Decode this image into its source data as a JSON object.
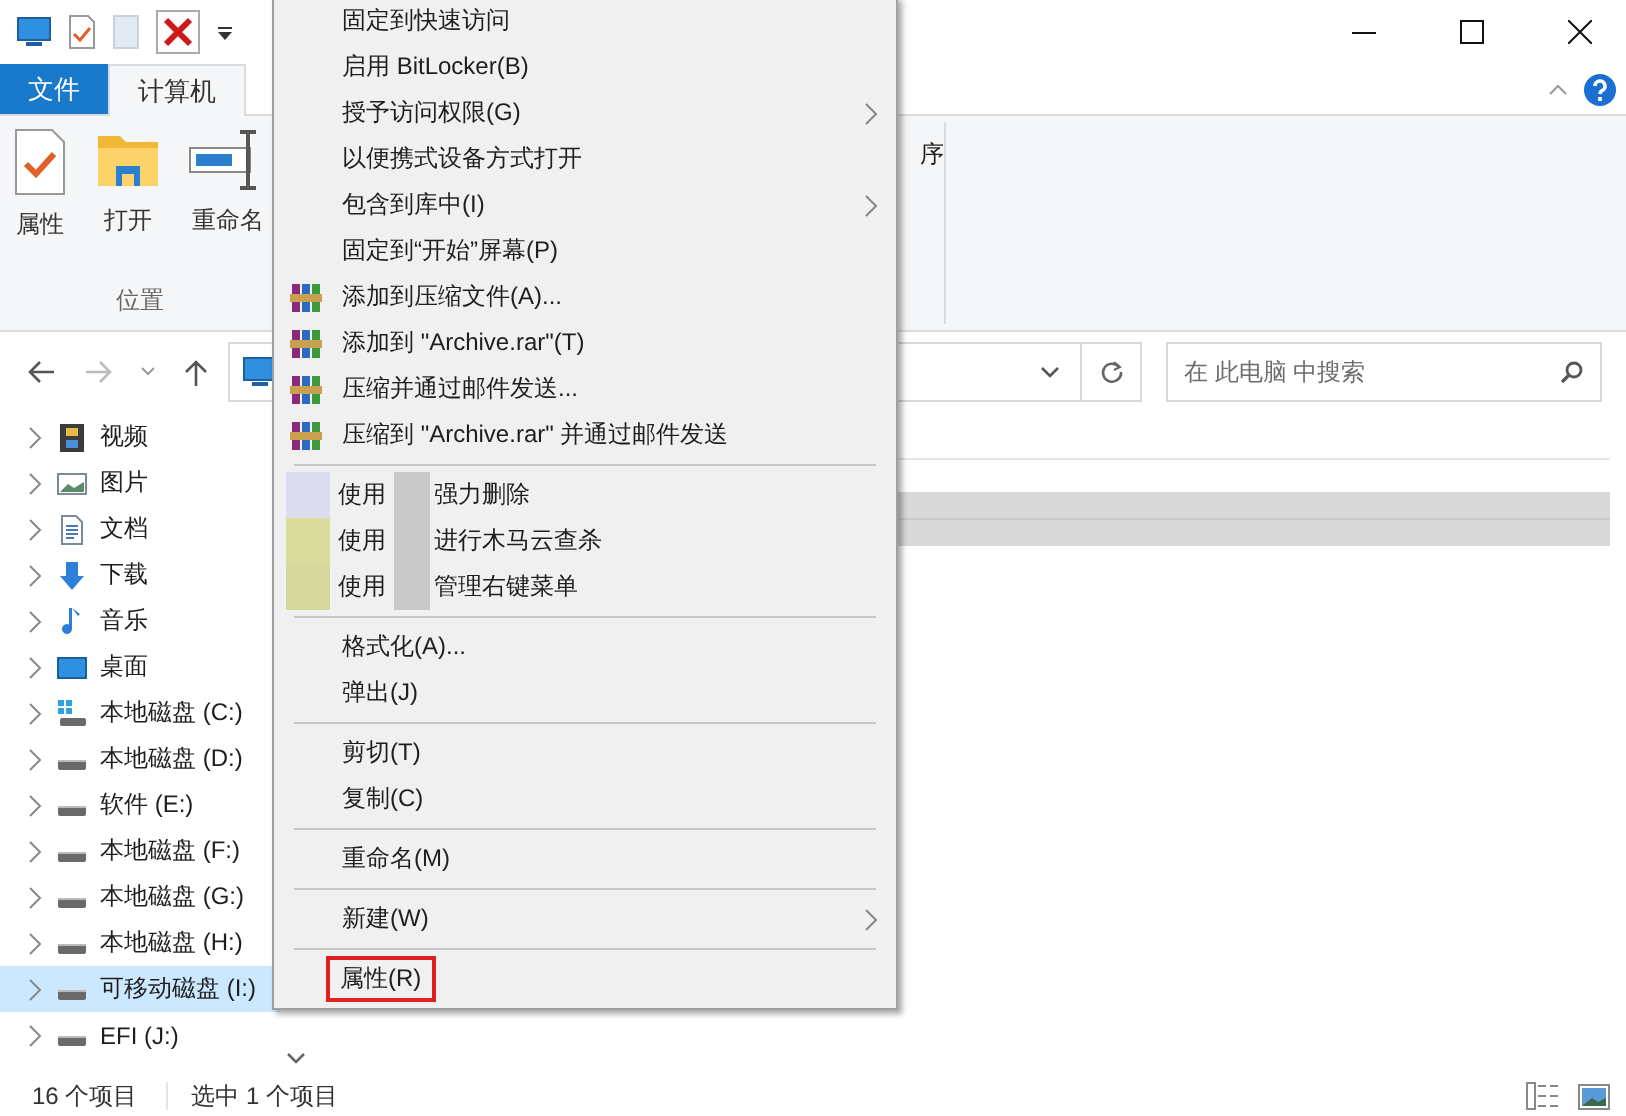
{
  "ribbon": {
    "tabs": [
      {
        "label": "文件",
        "kind": "file",
        "selected": false
      },
      {
        "label": "计算机",
        "kind": "tab",
        "selected": true
      }
    ],
    "buttons": [
      {
        "label": "属性",
        "kind": "properties"
      },
      {
        "label": "打开",
        "kind": "open"
      },
      {
        "label": "重命名",
        "kind": "rename"
      }
    ],
    "group_label": "位置",
    "cut_label": "序"
  },
  "search": {
    "placeholder": "在 此电脑 中搜索"
  },
  "nav": [
    {
      "label": "视频",
      "kind": "video",
      "selected": false
    },
    {
      "label": "图片",
      "kind": "picture",
      "selected": false
    },
    {
      "label": "文档",
      "kind": "document",
      "selected": false
    },
    {
      "label": "下载",
      "kind": "download",
      "selected": false
    },
    {
      "label": "音乐",
      "kind": "music",
      "selected": false
    },
    {
      "label": "桌面",
      "kind": "desktop",
      "selected": false
    },
    {
      "label": "本地磁盘 (C:)",
      "kind": "system",
      "selected": false
    },
    {
      "label": "本地磁盘 (D:)",
      "kind": "drive",
      "selected": false
    },
    {
      "label": "软件 (E:)",
      "kind": "drive",
      "selected": false
    },
    {
      "label": "本地磁盘 (F:)",
      "kind": "drive",
      "selected": false
    },
    {
      "label": "本地磁盘 (G:)",
      "kind": "drive",
      "selected": false
    },
    {
      "label": "本地磁盘 (H:)",
      "kind": "drive",
      "selected": false
    },
    {
      "label": "可移动磁盘 (I:)",
      "kind": "drive",
      "selected": true
    },
    {
      "label": "EFI (J:)",
      "kind": "drive",
      "selected": false
    }
  ],
  "menu": [
    {
      "kind": "item",
      "label": "固定到快速访问",
      "submenu": false,
      "highlighted": false
    },
    {
      "kind": "item",
      "label": "启用 BitLocker(B)",
      "submenu": false,
      "highlighted": false
    },
    {
      "kind": "item",
      "label": "授予访问权限(G)",
      "submenu": true,
      "highlighted": false
    },
    {
      "kind": "item",
      "label": "以便携式设备方式打开",
      "submenu": false,
      "highlighted": false
    },
    {
      "kind": "item",
      "label": "包含到库中(I)",
      "submenu": true,
      "highlighted": false
    },
    {
      "kind": "item",
      "label": "固定到“开始”屏幕(P)",
      "submenu": false,
      "highlighted": false
    },
    {
      "kind": "archive",
      "label": "添加到压缩文件(A)...",
      "submenu": false,
      "highlighted": false
    },
    {
      "kind": "archive",
      "label": "添加到 \"Archive.rar\"(T)",
      "submenu": false,
      "highlighted": false
    },
    {
      "kind": "archive",
      "label": "压缩并通过邮件发送...",
      "submenu": false,
      "highlighted": false
    },
    {
      "kind": "archive",
      "label": "压缩到 \"Archive.rar\" 并通过邮件发送",
      "submenu": false,
      "highlighted": false
    },
    {
      "kind": "separator"
    },
    {
      "kind": "redacted",
      "label": "使用",
      "rest": "强力删除",
      "color": "#dcdcef"
    },
    {
      "kind": "redacted",
      "label": "使用",
      "rest": "进行木马云查杀",
      "color": "#d8dc9c"
    },
    {
      "kind": "redacted",
      "label": "使用",
      "rest": "管理右键菜单",
      "color": "#d4d89a"
    },
    {
      "kind": "separator"
    },
    {
      "kind": "item",
      "label": "格式化(A)...",
      "submenu": false,
      "highlighted": false
    },
    {
      "kind": "item",
      "label": "弹出(J)",
      "submenu": false,
      "highlighted": false
    },
    {
      "kind": "separator"
    },
    {
      "kind": "item",
      "label": "剪切(T)",
      "submenu": false,
      "highlighted": false
    },
    {
      "kind": "item",
      "label": "复制(C)",
      "submenu": false,
      "highlighted": false
    },
    {
      "kind": "separator"
    },
    {
      "kind": "item",
      "label": "重命名(M)",
      "submenu": false,
      "highlighted": false
    },
    {
      "kind": "separator"
    },
    {
      "kind": "item",
      "label": "新建(W)",
      "submenu": true,
      "highlighted": false
    },
    {
      "kind": "separator"
    },
    {
      "kind": "item",
      "label": "属性(R)",
      "submenu": false,
      "highlighted": true
    }
  ],
  "status": {
    "count": "16 个项目",
    "selection": "选中 1 个项目"
  }
}
